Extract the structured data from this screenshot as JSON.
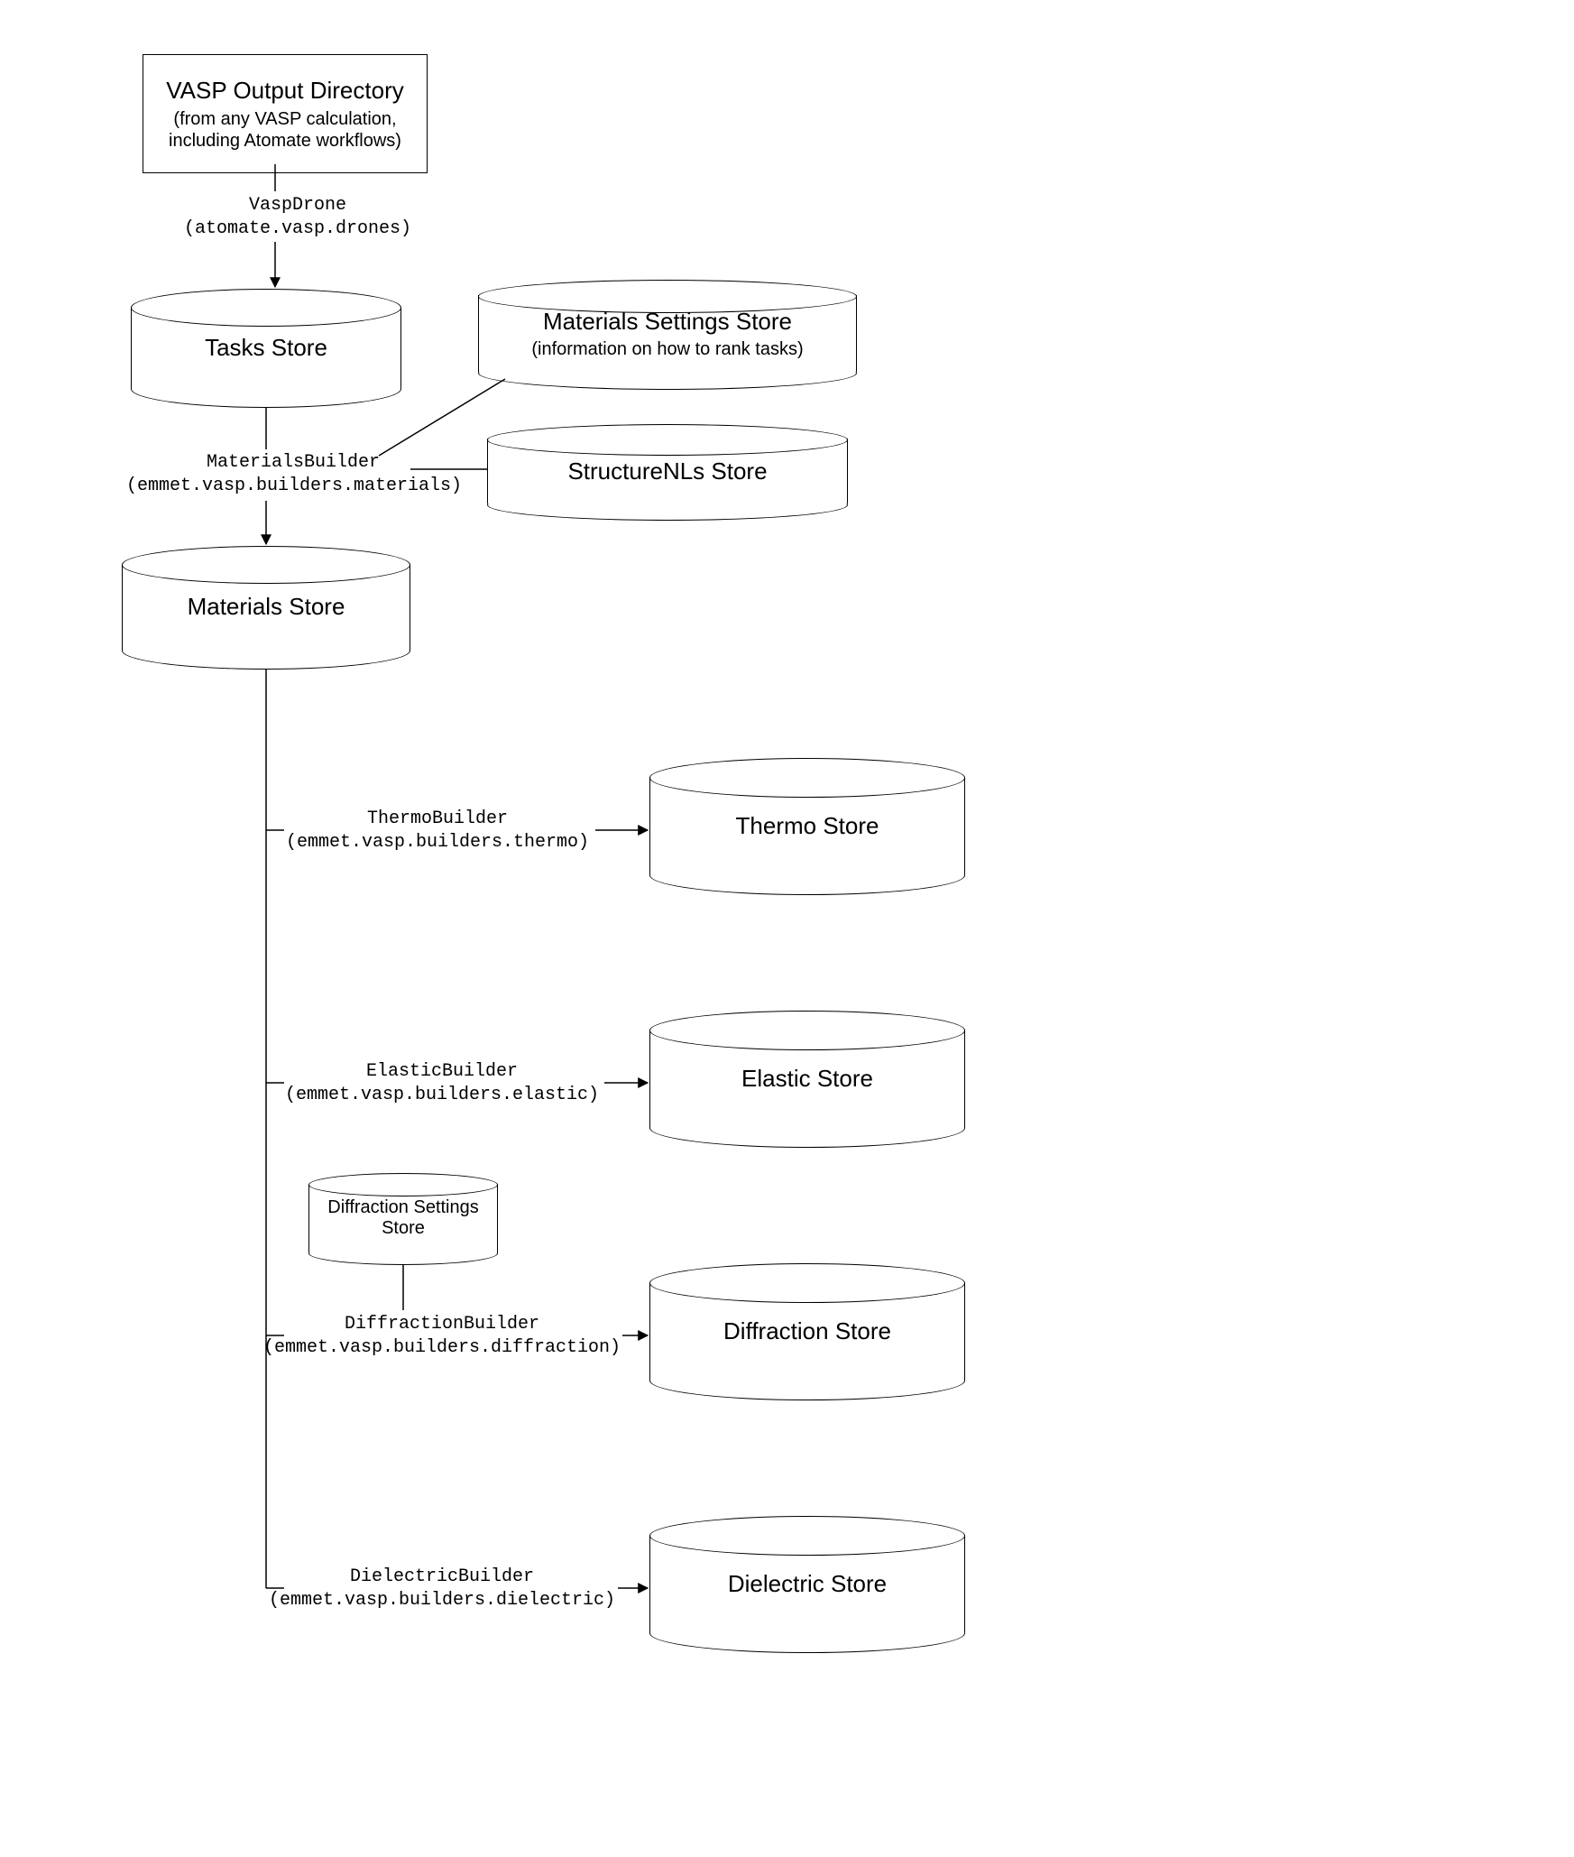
{
  "box_vasp": {
    "title": "VASP Output Directory",
    "sub1": "(from any VASP calculation,",
    "sub2": "including Atomate workflows)"
  },
  "label_vaspdrone1": "VaspDrone",
  "label_vaspdrone2": "(atomate.vasp.drones)",
  "cyl_tasks": {
    "title": "Tasks Store"
  },
  "cyl_matset": {
    "title": "Materials Settings Store",
    "sub": "(information on how to rank tasks)"
  },
  "cyl_snl": {
    "title": "StructureNLs Store"
  },
  "label_matbuild1": "MaterialsBuilder",
  "label_matbuild2": "(emmet.vasp.builders.materials)",
  "cyl_materials": {
    "title": "Materials Store"
  },
  "label_thermo1": "ThermoBuilder",
  "label_thermo2": "(emmet.vasp.builders.thermo)",
  "cyl_thermo": {
    "title": "Thermo Store"
  },
  "label_elastic1": "ElasticBuilder",
  "label_elastic2": "(emmet.vasp.builders.elastic)",
  "cyl_elastic": {
    "title": "Elastic Store"
  },
  "cyl_diffset": {
    "title1": "Diffraction Settings",
    "title2": "Store"
  },
  "label_diff1": "DiffractionBuilder",
  "label_diff2": "(emmet.vasp.builders.diffraction)",
  "cyl_diff": {
    "title": "Diffraction Store"
  },
  "label_diel1": "DielectricBuilder",
  "label_diel2": "(emmet.vasp.builders.dielectric)",
  "cyl_diel": {
    "title": "Dielectric Store"
  }
}
